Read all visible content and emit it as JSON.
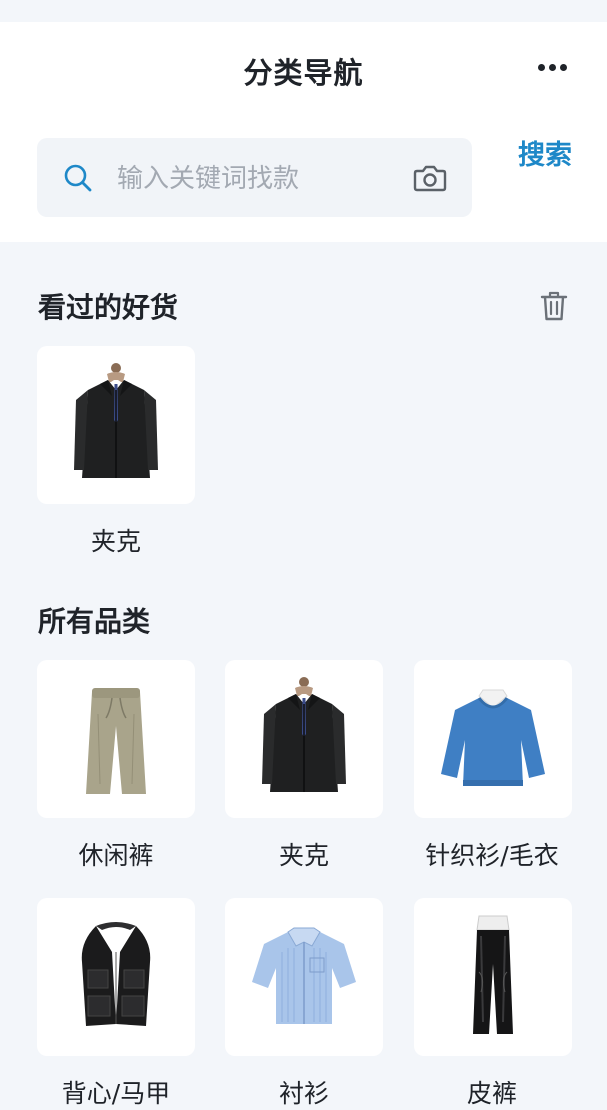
{
  "header": {
    "title": "分类导航"
  },
  "search": {
    "placeholder": "输入关键词找款",
    "value": "",
    "button_label": "搜索"
  },
  "recent": {
    "title": "看过的好货",
    "items": [
      {
        "label": "夹克",
        "icon": "jacket"
      }
    ]
  },
  "categories": {
    "title": "所有品类",
    "items": [
      {
        "label": "休闲裤",
        "icon": "casual-pants"
      },
      {
        "label": "夹克",
        "icon": "jacket"
      },
      {
        "label": "针织衫/毛衣",
        "icon": "sweater"
      },
      {
        "label": "背心/马甲",
        "icon": "vest"
      },
      {
        "label": "衬衫",
        "icon": "shirt"
      },
      {
        "label": "皮裤",
        "icon": "leather-pants"
      }
    ]
  },
  "colors": {
    "accent": "#1e88c8",
    "background": "#f3f6fa",
    "card": "#ffffff"
  }
}
